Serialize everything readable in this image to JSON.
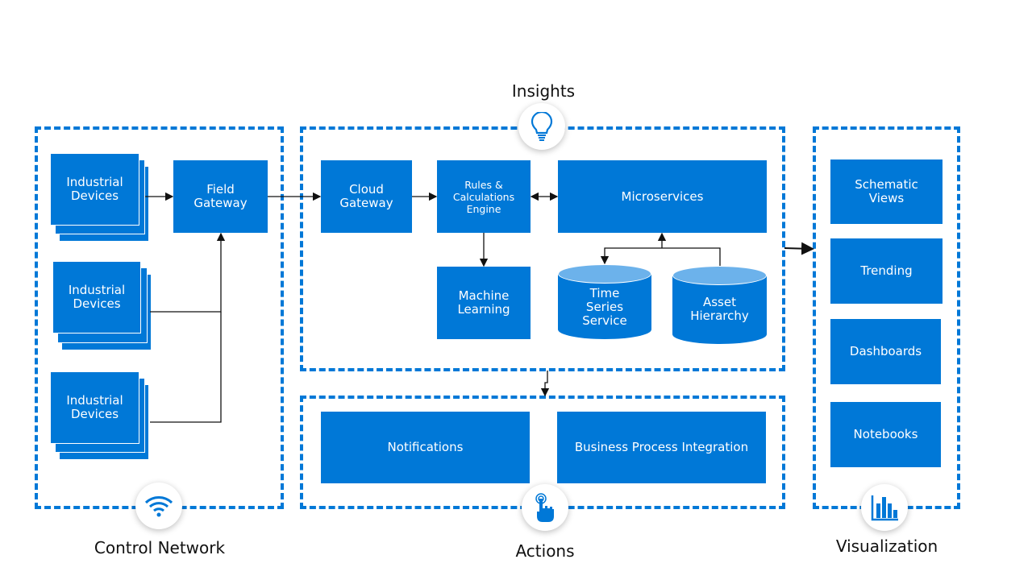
{
  "sections": {
    "insights": "Insights",
    "control_network": "Control Network",
    "actions": "Actions",
    "visualization": "Visualization"
  },
  "control_network": {
    "devices": [
      "Industrial Devices",
      "Industrial Devices",
      "Industrial Devices"
    ],
    "field_gateway": "Field Gateway"
  },
  "insights": {
    "cloud_gateway": "Cloud Gateway",
    "rules_engine": "Rules & Calculations Engine",
    "microservices": "Microservices",
    "machine_learning": "Machine Learning",
    "time_series": "Time Series Service",
    "asset_hierarchy": "Asset Hierarchy"
  },
  "actions": {
    "notifications": "Notifications",
    "business_process": "Business Process Integration"
  },
  "visualization": {
    "items": [
      "Schematic Views",
      "Trending",
      "Dashboards",
      "Notebooks"
    ]
  },
  "icons": {
    "insights": "lightbulb-icon",
    "control_network": "wifi-icon",
    "actions": "touch-hand-icon",
    "visualization": "bar-chart-icon"
  },
  "colors": {
    "accent": "#0078d7",
    "cylinder_top": "#6cb2eb"
  }
}
